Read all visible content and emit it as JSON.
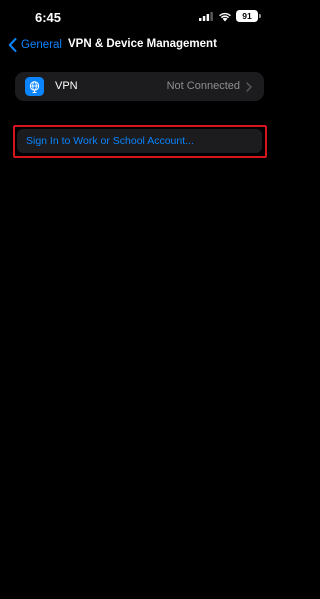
{
  "status_bar": {
    "time": "6:45",
    "battery": "91",
    "icons": [
      "signal-icon",
      "wifi-icon",
      "battery-icon"
    ]
  },
  "nav": {
    "back_label": "General",
    "title": "VPN & Device Management"
  },
  "vpn": {
    "label": "VPN",
    "value": "Not Connected",
    "icon": "globe-icon"
  },
  "account": {
    "sign_in_label": "Sign In to Work or School Account..."
  },
  "colors": {
    "accent": "#0a84ff",
    "cell_background": "#1c1c1e",
    "secondary_text": "#8e8e93",
    "highlight_border": "#d4151c"
  }
}
